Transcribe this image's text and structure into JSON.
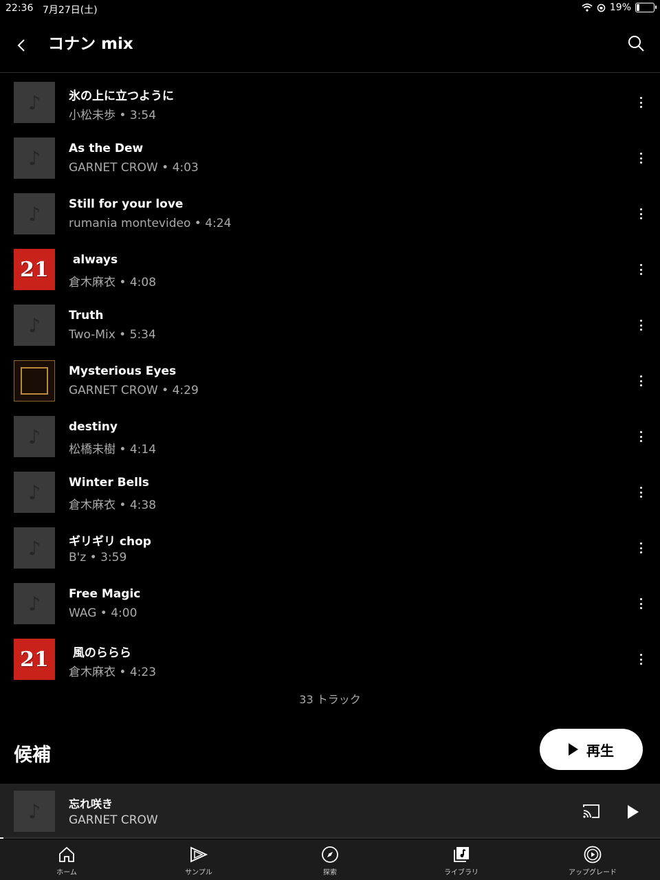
{
  "status_bar": {
    "time": "22:36",
    "date": "7月27日(土)",
    "battery": "19%",
    "battery_level": 0.19
  },
  "header": {
    "title": "コナン mix",
    "back_icon": "chevron-left-icon",
    "search_icon": "search-icon"
  },
  "tracks": [
    {
      "title": "氷の上に立つように",
      "artist": "小松未歩",
      "duration": "3:54",
      "art": "placeholder"
    },
    {
      "title": "As the Dew",
      "artist": "GARNET CROW",
      "duration": "4:03",
      "art": "placeholder"
    },
    {
      "title": "Still for your love",
      "artist": "rumania montevideo",
      "duration": "4:24",
      "art": "placeholder"
    },
    {
      "title": " always",
      "artist": "倉木麻衣",
      "duration": "4:08",
      "art": "red-collaboration",
      "art_text": "21"
    },
    {
      "title": "Truth",
      "artist": "Two-Mix",
      "duration": "5:34",
      "art": "placeholder"
    },
    {
      "title": "Mysterious Eyes",
      "artist": "GARNET CROW",
      "duration": "4:29",
      "art": "gold-frame"
    },
    {
      "title": "destiny",
      "artist": "松橋未樹",
      "duration": "4:14",
      "art": "placeholder"
    },
    {
      "title": "Winter Bells",
      "artist": "倉木麻衣",
      "duration": "4:38",
      "art": "placeholder"
    },
    {
      "title": "ギリギリ chop",
      "artist": "B'z",
      "duration": "3:59",
      "art": "placeholder"
    },
    {
      "title": "Free Magic",
      "artist": "WAG",
      "duration": "4:00",
      "art": "placeholder"
    },
    {
      "title": " 風のららら",
      "artist": "倉木麻衣",
      "duration": "4:23",
      "art": "red-collaboration",
      "art_text": "21"
    }
  ],
  "track_count": "33 トラック",
  "suggestions_title": "候補",
  "play_button": "再生",
  "mini_player": {
    "title": "忘れ咲き",
    "artist": "GARNET CROW",
    "progress": 0.005
  },
  "nav": [
    {
      "label": "ホーム",
      "icon": "home-icon"
    },
    {
      "label": "サンプル",
      "icon": "samples-icon"
    },
    {
      "label": "探索",
      "icon": "explore-icon"
    },
    {
      "label": "ライブラリ",
      "icon": "library-icon"
    },
    {
      "label": "アップグレード",
      "icon": "upgrade-icon"
    }
  ],
  "colors": {
    "background": "#000000",
    "mini_player": "#212121",
    "nav": "#1c1c1c",
    "secondary_text": "#aaaaaa"
  }
}
